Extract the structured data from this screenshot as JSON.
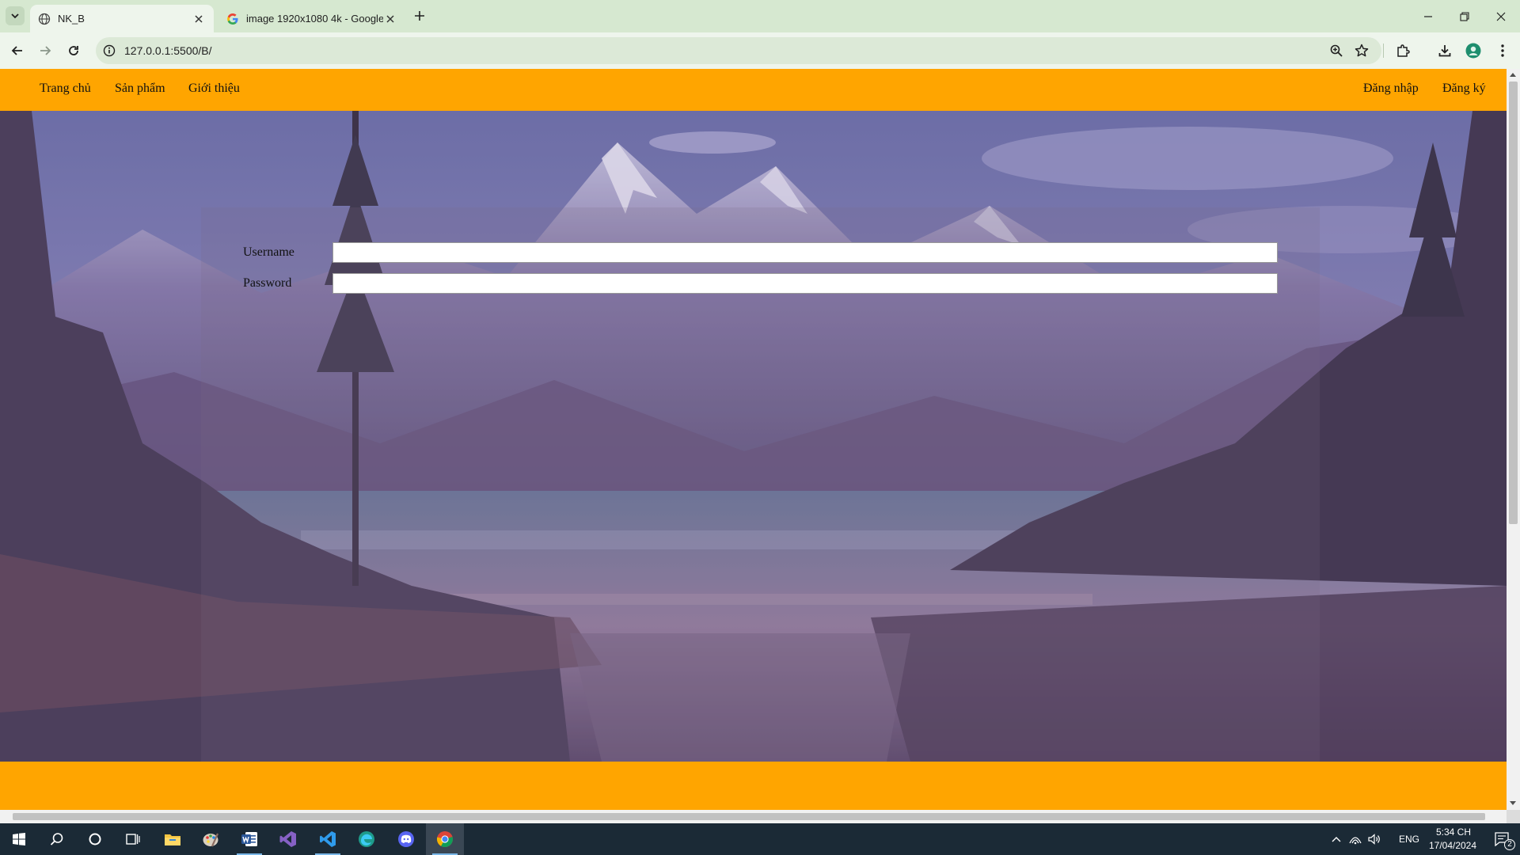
{
  "browser": {
    "tabs": [
      {
        "title": "NK_B",
        "active": true
      },
      {
        "title": "image 1920x1080 4k - Google",
        "active": false
      }
    ],
    "url": "127.0.0.1:5500/B/"
  },
  "site": {
    "nav_left": [
      "Trang chủ",
      "Sản phẩm",
      "Giới thiệu"
    ],
    "nav_right": [
      "Đăng nhập",
      "Đăng ký"
    ],
    "form": {
      "username_label": "Username",
      "password_label": "Password",
      "username_value": "",
      "password_value": ""
    }
  },
  "taskbar": {
    "language": "ENG",
    "time": "5:34 CH",
    "date": "17/04/2024",
    "notification_count": "2"
  },
  "colors": {
    "nav_bar": "#ffa500",
    "footer_bar": "#ffa500",
    "browser_frame": "#d6e8d0"
  },
  "icons": {
    "taskbar_apps": [
      "windows-start-icon",
      "search-icon",
      "cortana-icon",
      "task-view-icon",
      "file-explorer-icon",
      "paint-icon",
      "word-icon",
      "visual-studio-icon",
      "vscode-icon",
      "edge-icon",
      "discord-icon",
      "chrome-icon"
    ]
  }
}
